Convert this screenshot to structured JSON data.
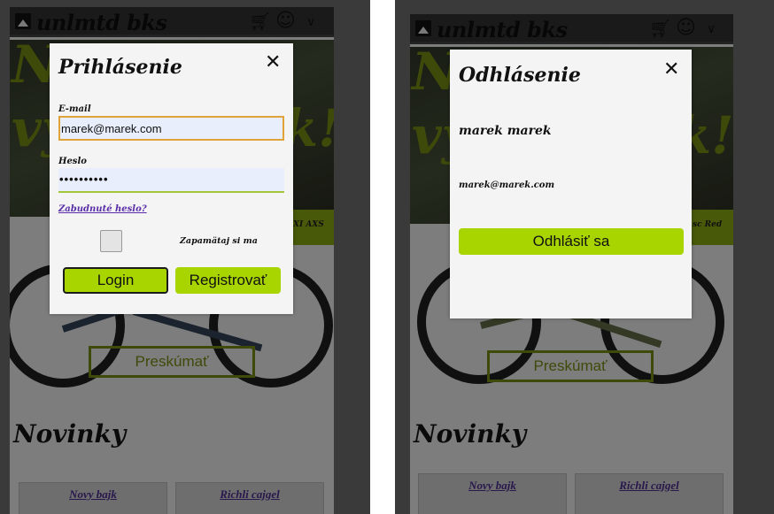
{
  "header": {
    "logo": "unlmtd bks",
    "cart_icon": "cart-icon",
    "account_icon": "account-icon",
    "menu_icon": "chevron-down-icon"
  },
  "hero": {
    "line1": "Na",
    "line2": "vy",
    "line2_end": "k!",
    "strip_left": "XI AXS",
    "strip_right": "sc Red"
  },
  "explore_label": "Preskúmať",
  "section_title": "Novinky",
  "cards": [
    "Novy bajk",
    "Richli cajgel"
  ],
  "login_modal": {
    "title": "Prihlásenie",
    "email_label": "E-mail",
    "email_value": "marek@marek.com",
    "password_label": "Heslo",
    "password_value": "••••••••••",
    "forgot_link": "Zabudnuté heslo?",
    "remember_label": "Zapamätaj si ma",
    "login_button": "Login",
    "register_button": "Registrovať"
  },
  "logout_modal": {
    "title": "Odhlásenie",
    "user_name": "marek marek",
    "user_email": "marek@marek.com",
    "logout_button": "Odhlásiť sa"
  },
  "colors": {
    "accent": "#a8d400",
    "panel_bg": "#3a3a3a",
    "link": "#5a2da8"
  }
}
